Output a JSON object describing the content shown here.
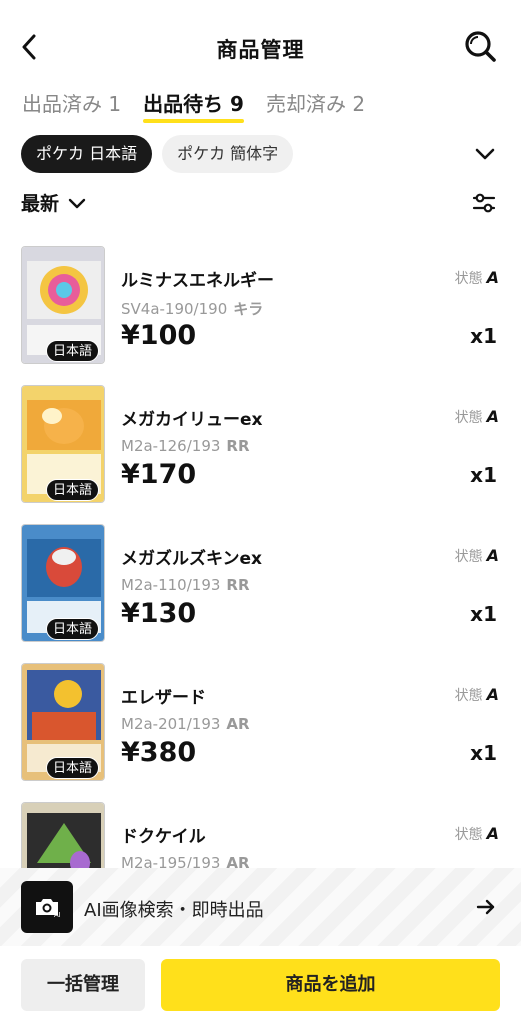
{
  "header": {
    "title": "商品管理"
  },
  "tabs": [
    {
      "label": "出品済み 1",
      "active": false
    },
    {
      "label": "出品待ち 9",
      "active": true
    },
    {
      "label": "売却済み 2",
      "active": false
    }
  ],
  "chips": [
    {
      "label": "ポケカ 日本語",
      "active": true
    },
    {
      "label": "ポケカ 簡体字",
      "active": false
    }
  ],
  "sort": {
    "label": "最新"
  },
  "items": [
    {
      "name": "ルミナスエネルギー",
      "code": "SV4a-190/190",
      "rarity": "キラ",
      "price": "¥100",
      "cond_label": "状態",
      "grade": "A",
      "qty": "x1",
      "lang": "日本語",
      "card_color": "#c9c9d6"
    },
    {
      "name": "メガカイリューex",
      "code": "M2a-126/193",
      "rarity": "RR",
      "price": "¥170",
      "cond_label": "状態",
      "grade": "A",
      "qty": "x1",
      "lang": "日本語",
      "card_color": "#f0a93a"
    },
    {
      "name": "メガズルズキンex",
      "code": "M2a-110/193",
      "rarity": "RR",
      "price": "¥130",
      "cond_label": "状態",
      "grade": "A",
      "qty": "x1",
      "lang": "日本語",
      "card_color": "#2a6aa8"
    },
    {
      "name": "エレザード",
      "code": "M2a-201/193",
      "rarity": "AR",
      "price": "¥380",
      "cond_label": "状態",
      "grade": "A",
      "qty": "x1",
      "lang": "日本語",
      "card_color": "#d9562e"
    },
    {
      "name": "ドクケイル",
      "code": "M2a-195/193",
      "rarity": "AR",
      "price": "",
      "cond_label": "状態",
      "grade": "A",
      "qty": "",
      "lang": "",
      "card_color": "#3b3b3b"
    }
  ],
  "ai_bar": {
    "label": "AI画像検索・即時出品"
  },
  "bottom": {
    "bulk_label": "一括管理",
    "add_label": "商品を追加"
  }
}
